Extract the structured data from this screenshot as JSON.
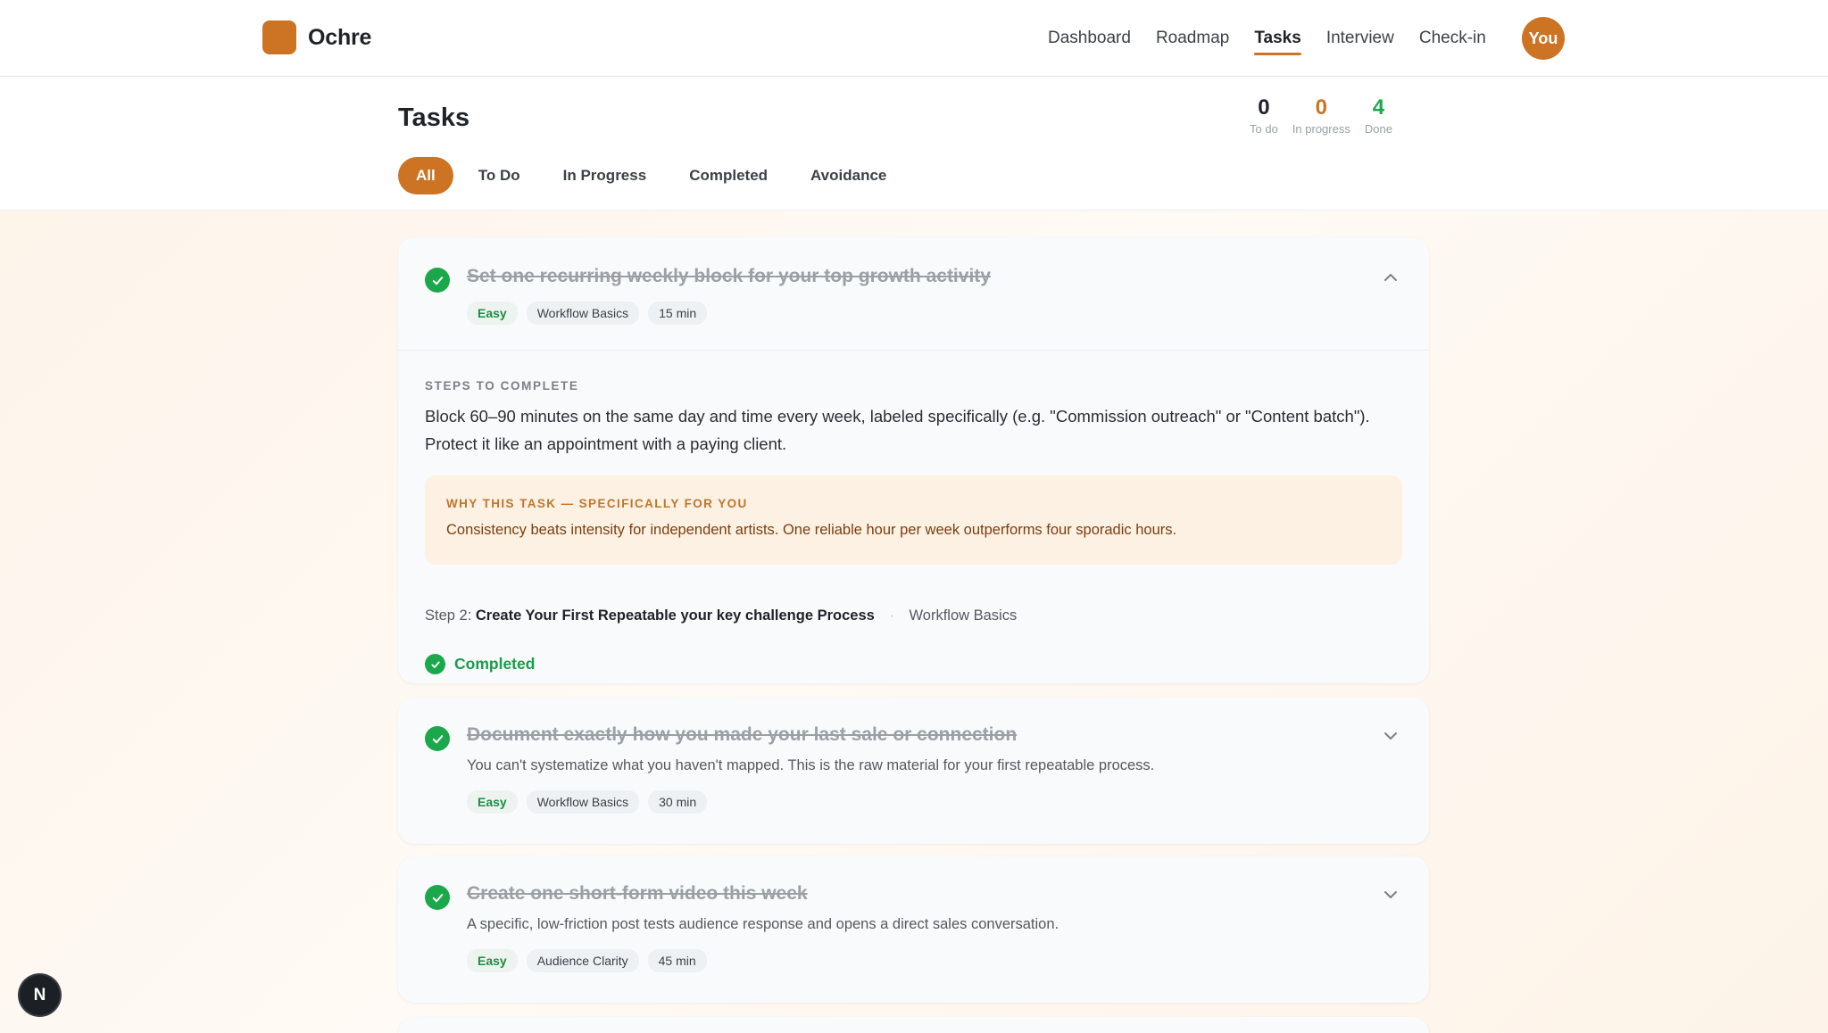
{
  "brand": {
    "name": "Ochre"
  },
  "nav": {
    "links": [
      "Dashboard",
      "Roadmap",
      "Tasks",
      "Interview",
      "Check-in"
    ],
    "active": "Tasks",
    "avatar": "You"
  },
  "page": {
    "title": "Tasks",
    "stats": [
      {
        "value": "0",
        "label": "To do",
        "color": "#1f2328"
      },
      {
        "value": "0",
        "label": "In progress",
        "color": "#cc7424"
      },
      {
        "value": "4",
        "label": "Done",
        "color": "#1aa84a"
      }
    ],
    "filters": [
      "All",
      "To Do",
      "In Progress",
      "Completed",
      "Avoidance"
    ],
    "active_filter": "All"
  },
  "tasks": [
    {
      "title": "Set one recurring weekly block for your top growth activity",
      "tags": [
        "Easy",
        "Workflow Basics",
        "15 min"
      ],
      "expanded": true,
      "steps_label": "STEPS TO COMPLETE",
      "steps_text": "Block 60–90 minutes on the same day and time every week, labeled specifically (e.g. \"Commission outreach\" or \"Content batch\"). Protect it like an appointment with a paying client.",
      "why_label": "WHY THIS TASK — SPECIFICALLY FOR YOU",
      "why_text": "Consistency beats intensity for independent artists. One reliable hour per week outperforms four sporadic hours.",
      "step_prefix": "Step 2:",
      "step_name": "Create Your First Repeatable your key challenge Process",
      "step_sep": "·",
      "step_category": "Workflow Basics",
      "status": "Completed"
    },
    {
      "title": "Document exactly how you made your last sale or connection",
      "desc": "You can't systematize what you haven't mapped. This is the raw material for your first repeatable process.",
      "tags": [
        "Easy",
        "Workflow Basics",
        "30 min"
      ],
      "expanded": false
    },
    {
      "title": "Create one short-form video this week",
      "desc": "A specific, low-friction post tests audience response and opens a direct sales conversation.",
      "tags": [
        "Easy",
        "Audience Clarity",
        "45 min"
      ],
      "expanded": false
    }
  ],
  "dev_badge": "N",
  "colors": {
    "accent": "#cc7424",
    "success": "#1aa84a"
  }
}
